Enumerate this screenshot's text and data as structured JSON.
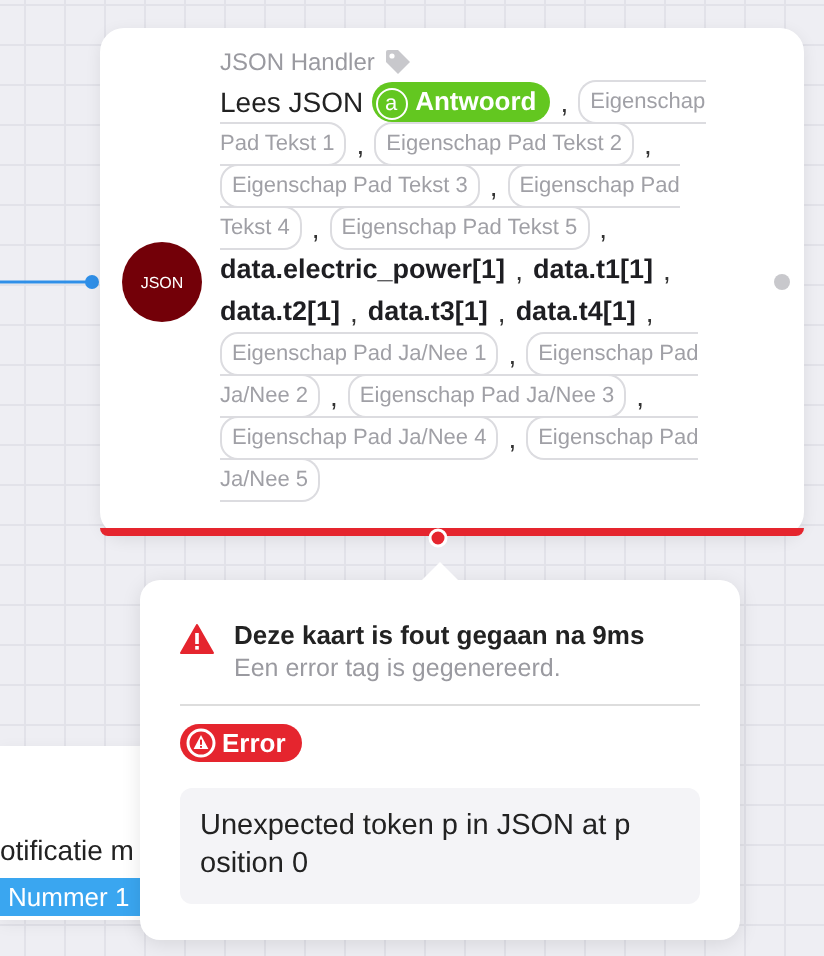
{
  "node": {
    "type_label": "JSON Handler",
    "avatar": "JSON",
    "lines": [
      [
        {
          "kind": "title",
          "text": "Lees JSON"
        },
        {
          "kind": "badge",
          "icon": "a",
          "text": "Antwoord"
        },
        {
          "kind": "comma",
          "text": ","
        },
        {
          "kind": "pill-head",
          "text": "Eigenschap"
        }
      ],
      [
        {
          "kind": "pill-tail",
          "text": "Pad Tekst 1"
        },
        {
          "kind": "comma",
          "text": ","
        },
        {
          "kind": "pill",
          "text": "Eigenschap Pad Tekst 2"
        },
        {
          "kind": "comma",
          "text": ","
        }
      ],
      [
        {
          "kind": "pill",
          "text": "Eigenschap Pad Tekst 3"
        },
        {
          "kind": "comma",
          "text": ","
        },
        {
          "kind": "pill-head",
          "text": "Eigenschap Pad"
        }
      ],
      [
        {
          "kind": "pill-tail",
          "text": "Tekst 4"
        },
        {
          "kind": "comma",
          "text": ","
        },
        {
          "kind": "pill",
          "text": "Eigenschap Pad Tekst 5"
        },
        {
          "kind": "comma",
          "text": ","
        }
      ],
      [
        {
          "kind": "path",
          "text": "data.electric_power[1]"
        },
        {
          "kind": "comma",
          "text": ","
        },
        {
          "kind": "path",
          "text": "data.t1[1]"
        },
        {
          "kind": "comma",
          "text": ","
        }
      ],
      [
        {
          "kind": "path",
          "text": "data.t2[1]"
        },
        {
          "kind": "comma",
          "text": ","
        },
        {
          "kind": "path",
          "text": "data.t3[1]"
        },
        {
          "kind": "comma",
          "text": ","
        },
        {
          "kind": "path",
          "text": "data.t4[1]"
        },
        {
          "kind": "comma",
          "text": ","
        }
      ],
      [
        {
          "kind": "pill",
          "text": "Eigenschap Pad Ja/Nee 1"
        },
        {
          "kind": "comma",
          "text": ","
        },
        {
          "kind": "pill-head",
          "text": "Eigenschap Pad"
        }
      ],
      [
        {
          "kind": "pill-tail",
          "text": "Ja/Nee 2"
        },
        {
          "kind": "comma",
          "text": ","
        },
        {
          "kind": "pill",
          "text": "Eigenschap Pad Ja/Nee 3"
        },
        {
          "kind": "comma",
          "text": ","
        }
      ],
      [
        {
          "kind": "pill",
          "text": "Eigenschap Pad Ja/Nee 4"
        },
        {
          "kind": "comma",
          "text": ","
        },
        {
          "kind": "pill-head",
          "text": "Eigenschap Pad"
        }
      ],
      [
        {
          "kind": "pill-tail",
          "text": "Ja/Nee 5"
        }
      ]
    ]
  },
  "other_node": {
    "title": "otificatie m",
    "tag": "Nummer 1"
  },
  "error_popup": {
    "title": "Deze kaart is fout gegaan na 9ms",
    "subtitle": "Een error tag is gegenereerd.",
    "badge": "Error",
    "message": "Unexpected token p in JSON at position 0"
  }
}
